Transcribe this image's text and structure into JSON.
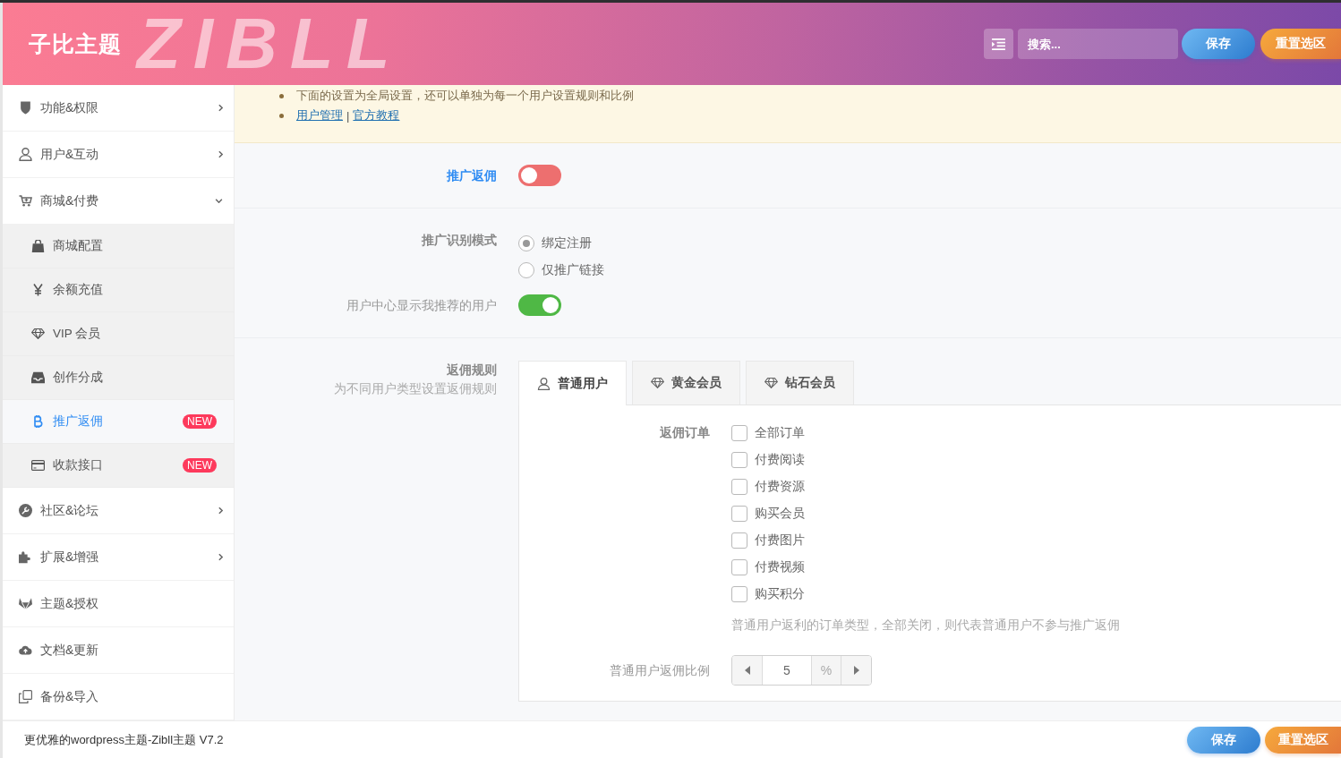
{
  "header": {
    "logo": "子比主题",
    "background_text": "ZIBLL",
    "search": {
      "placeholder": "搜索..."
    },
    "buttons": [
      {
        "kind": "save",
        "label": "保存"
      },
      {
        "kind": "reset",
        "label": "重置选区"
      }
    ]
  },
  "sidebar": {
    "items": [
      {
        "kind": "group",
        "label": "功能&权限",
        "selected": false,
        "expanded": false
      },
      {
        "kind": "group",
        "label": "用户&互动",
        "selected": false,
        "expanded": false
      },
      {
        "kind": "group",
        "label": "商城&付费",
        "selected": false,
        "expanded": true,
        "children": [
          {
            "label": "商城配置",
            "selected": false
          },
          {
            "label": "余额充值",
            "selected": false
          },
          {
            "label": "VIP 会员",
            "selected": false
          },
          {
            "label": "创作分成",
            "selected": false
          },
          {
            "label": "推广返佣",
            "selected": true,
            "badge": "NEW"
          },
          {
            "label": "收款接口",
            "selected": false,
            "badge": "NEW"
          }
        ]
      },
      {
        "kind": "group",
        "label": "社区&论坛",
        "selected": false,
        "expanded": false
      },
      {
        "kind": "group",
        "label": "扩展&增强",
        "selected": false,
        "expanded": false
      },
      {
        "kind": "link",
        "label": "主题&授权",
        "selected": false
      },
      {
        "kind": "link",
        "label": "文档&更新",
        "selected": false
      },
      {
        "kind": "link",
        "label": "备份&导入",
        "selected": false
      }
    ]
  },
  "notice": {
    "lines": [
      {
        "kind": "text",
        "text": "下面的设置为全局设置，还可以单独为每一个用户设置规则和比例"
      },
      {
        "kind": "links",
        "links": [
          "用户管理",
          "官方教程"
        ],
        "separator": "|"
      }
    ]
  },
  "sections": [
    {
      "fields": [
        {
          "kind": "switch",
          "label": "推广返佣",
          "highlighted": true,
          "muted": false,
          "on": false
        }
      ]
    },
    {
      "fields": [
        {
          "kind": "radio",
          "label": "推广识别模式",
          "highlighted": false,
          "muted": false,
          "options": [
            {
              "label": "绑定注册",
              "selected": true
            },
            {
              "label": "仅推广链接",
              "selected": false
            }
          ]
        },
        {
          "kind": "switch",
          "label": "用户中心显示我推荐的用户",
          "highlighted": false,
          "muted": true,
          "on": true
        }
      ]
    },
    {
      "fields": [
        {
          "kind": "tabs",
          "label": "返佣规则",
          "highlighted": false,
          "muted": false,
          "description": "为不同用户类型设置返佣规则",
          "tabs": [
            {
              "label": "普通用户",
              "selected": true
            },
            {
              "label": "黄金会员",
              "selected": false
            },
            {
              "label": "钻石会员",
              "selected": false
            }
          ],
          "panel": [
            {
              "kind": "checkboxes",
              "label": "返佣订单",
              "highlighted": false,
              "muted": false,
              "options": [
                {
                  "label": "全部订单",
                  "checked": false
                },
                {
                  "label": "付费阅读",
                  "checked": false
                },
                {
                  "label": "付费资源",
                  "checked": false
                },
                {
                  "label": "购买会员",
                  "checked": false
                },
                {
                  "label": "付费图片",
                  "checked": false
                },
                {
                  "label": "付费视频",
                  "checked": false
                },
                {
                  "label": "购买积分",
                  "checked": false
                }
              ],
              "help": "普通用户返利的订单类型，全部关闭，则代表普通用户不参与推广返佣"
            },
            {
              "kind": "spinner",
              "label": "普通用户返佣比例",
              "highlighted": false,
              "muted": true,
              "value": "5",
              "unit": "%"
            }
          ]
        }
      ]
    }
  ],
  "footer": {
    "text": "更优雅的wordpress主题-Zibll主题 V7.2",
    "buttons": [
      {
        "kind": "save",
        "label": "保存"
      },
      {
        "kind": "reset",
        "label": "重置选区"
      }
    ]
  }
}
